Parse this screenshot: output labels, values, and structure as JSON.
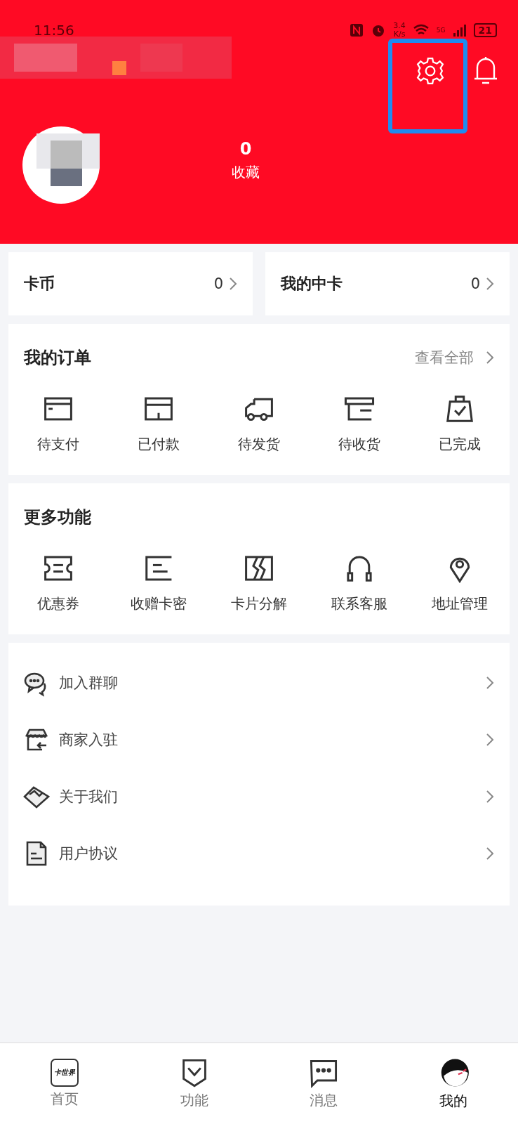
{
  "status_bar": {
    "time": "11:56",
    "net_speed": "3.4",
    "net_unit": "K/s",
    "signal_label": "5G",
    "battery": "21"
  },
  "header": {
    "stat_value": "0",
    "stat_label": "收藏",
    "highlight_settings": true
  },
  "balances": [
    {
      "label": "卡币",
      "value": "0"
    },
    {
      "label": "我的中卡",
      "value": "0"
    }
  ],
  "orders": {
    "title": "我的订单",
    "view_all": "查看全部",
    "items": [
      {
        "label": "待支付",
        "kind": "card"
      },
      {
        "label": "已付款",
        "kind": "box"
      },
      {
        "label": "待发货",
        "kind": "truck"
      },
      {
        "label": "待收货",
        "kind": "tray"
      },
      {
        "label": "已完成",
        "kind": "bag"
      }
    ]
  },
  "more": {
    "title": "更多功能",
    "items": [
      {
        "label": "优惠券",
        "kind": "ticket"
      },
      {
        "label": "收赠卡密",
        "kind": "code"
      },
      {
        "label": "卡片分解",
        "kind": "split"
      },
      {
        "label": "联系客服",
        "kind": "headset"
      },
      {
        "label": "地址管理",
        "kind": "pin"
      }
    ]
  },
  "menu": [
    {
      "label": "加入群聊",
      "kind": "chat"
    },
    {
      "label": "商家入驻",
      "kind": "shop"
    },
    {
      "label": "关于我们",
      "kind": "handshake"
    },
    {
      "label": "用户协议",
      "kind": "doc"
    }
  ],
  "tabs": [
    {
      "label": "首页",
      "kind": "logo",
      "logo_text": "卡世界",
      "selected": false
    },
    {
      "label": "功能",
      "kind": "shield",
      "selected": false
    },
    {
      "label": "消息",
      "kind": "message",
      "selected": false
    },
    {
      "label": "我的",
      "kind": "avatar",
      "selected": true
    }
  ]
}
